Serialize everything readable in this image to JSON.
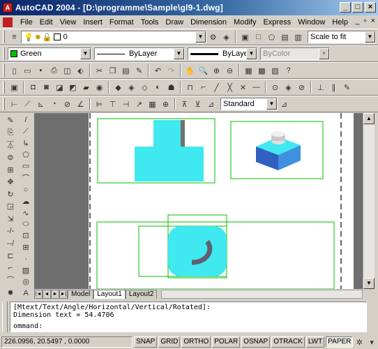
{
  "window": {
    "title": "AutoCAD 2004 - [D:\\programme\\Sample\\gl9-1.dwg]"
  },
  "menu": {
    "items": [
      "File",
      "Edit",
      "View",
      "Insert",
      "Format",
      "Tools",
      "Draw",
      "Dimension",
      "Modify",
      "Express",
      "Window",
      "Help"
    ]
  },
  "layer": {
    "current": "0",
    "named_view": "Scale to fit"
  },
  "properties": {
    "color": "Green",
    "color_hex": "#00c000",
    "linetype": "ByLayer",
    "lineweight": "ByLayer",
    "plotstyle": "ByColor"
  },
  "dimstyle": {
    "current": "Standard"
  },
  "layouts": {
    "tabs": [
      "Model",
      "Layout1",
      "Layout2"
    ],
    "active": 1
  },
  "command": {
    "line1": "[Mtext/Text/Angle/Horizontal/Vertical/Rotated]:",
    "line2": "Dimension text = 54.4706",
    "prompt": "ommand:"
  },
  "status": {
    "coords": "226.0956, 20.5497 , 0.0000",
    "toggles": [
      "SNAP",
      "GRID",
      "ORTHO",
      "POLAR",
      "OSNAP",
      "OTRACK",
      "LWT",
      "PAPER"
    ],
    "active_toggle": "PAPER"
  },
  "colors": {
    "title_start": "#0a246a",
    "viewport_line": "#00c000",
    "solid_cyan": "#40e8f0"
  },
  "icons": {
    "row_std": [
      "new-icon",
      "open-icon",
      "save-icon",
      "print-icon",
      "preview-icon",
      "publish-icon",
      "cut-icon",
      "copy-icon",
      "paste-icon",
      "matchprop-icon",
      "undo-icon",
      "redo-icon",
      "pan-icon",
      "zoom-realtime-icon",
      "zoom-window-icon",
      "zoom-previous-icon",
      "properties-icon",
      "designcenter-icon",
      "toolpalette-icon",
      "help-icon"
    ],
    "row_3d": [
      "box-icon",
      "sphere-icon",
      "cylinder-icon",
      "cone-icon",
      "wedge-icon",
      "torus-icon",
      "extrude-icon",
      "revolve-icon",
      "slice-icon",
      "section-icon",
      "interfere-icon",
      "setup-icon",
      "union-icon",
      "subtract-icon",
      "intersect-icon",
      "ucs-icon",
      "orbit-icon",
      "view-icon"
    ],
    "row_dim": [
      "linear-dim-icon",
      "aligned-dim-icon",
      "ordinate-dim-icon",
      "radius-dim-icon",
      "diameter-dim-icon",
      "angular-dim-icon",
      "quick-dim-icon",
      "baseline-dim-icon",
      "continue-dim-icon",
      "leader-icon",
      "tolerance-icon",
      "center-mark-icon",
      "dimedit-icon",
      "dimtedit-icon",
      "dimupdate-icon"
    ],
    "draw_col": [
      "line-icon",
      "xline-icon",
      "polyline-icon",
      "polygon-icon",
      "rectangle-icon",
      "arc-icon",
      "circle-icon",
      "revcloud-icon",
      "spline-icon",
      "ellipse-icon",
      "insert-block-icon",
      "make-block-icon",
      "point-icon",
      "hatch-icon",
      "region-icon",
      "mtext-icon"
    ],
    "modify_col": [
      "erase-icon",
      "copy-object-icon",
      "mirror-icon",
      "offset-icon",
      "array-icon",
      "move-icon",
      "rotate-icon",
      "scale-icon",
      "stretch-icon",
      "trim-icon",
      "extend-icon",
      "break-icon",
      "chamfer-icon",
      "fillet-icon",
      "explode-icon"
    ]
  }
}
